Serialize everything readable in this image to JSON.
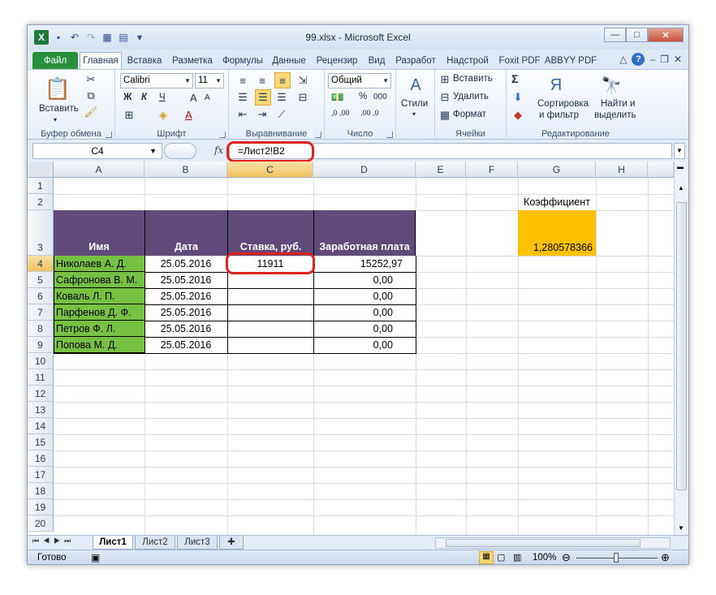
{
  "window": {
    "title": "99.xlsx - Microsoft Excel",
    "logo": "X",
    "buttons": {
      "minimize": "—",
      "maximize": "□",
      "close": "✕"
    }
  },
  "qat_icons": [
    "save-icon",
    "undo-icon",
    "redo-icon",
    "form-icon",
    "table-icon",
    "customize-icon"
  ],
  "tabs": [
    "Файл",
    "Главная",
    "Вставка",
    "Разметка",
    "Формулы",
    "Данные",
    "Рецензир",
    "Вид",
    "Разработ",
    "Надстрой",
    "Foxit PDF",
    "ABBYY PDF"
  ],
  "ribbon": {
    "clipboard": {
      "paste": "Вставить",
      "label": "Буфер обмена"
    },
    "font": {
      "name": "Calibri",
      "size": "11",
      "bold": "Ж",
      "italic": "К",
      "underline": "Ч",
      "grow": "A",
      "shrink": "A",
      "color": "A",
      "label": "Шрифт"
    },
    "alignment": {
      "label": "Выравнивание"
    },
    "number": {
      "format": "Общий",
      "percent": "%",
      "thousands": "000",
      "inc": ",0 ,00",
      "dec": ",00 ,0",
      "label": "Число"
    },
    "styles": {
      "label": "Стили"
    },
    "cells": {
      "insert": "Вставить",
      "delete": "Удалить",
      "format": "Формат",
      "label": "Ячейки"
    },
    "editing": {
      "sum": "Σ",
      "sort": "Сортировка\nи фильтр",
      "sort1": "Сортировка",
      "sort2": "и фильтр",
      "find1": "Найти и",
      "find2": "выделить",
      "label": "Редактирование"
    }
  },
  "formula_bar": {
    "name_box": "C4",
    "fx": "fx",
    "formula": "=Лист2!B2"
  },
  "columns": [
    "A",
    "B",
    "C",
    "D",
    "E",
    "F",
    "G",
    "H"
  ],
  "rows": [
    "1",
    "2",
    "3",
    "4",
    "5",
    "6",
    "7",
    "8",
    "9",
    "10",
    "11",
    "12",
    "13",
    "14",
    "15",
    "16",
    "17",
    "18",
    "19",
    "20"
  ],
  "table": {
    "headers": [
      "Имя",
      "Дата",
      "Ставка, руб.",
      "Заработная плата"
    ],
    "rows": [
      [
        "Николаев А. Д.",
        "25.05.2016",
        "11911",
        "15252,97"
      ],
      [
        "Сафронова В. М.",
        "25.05.2016",
        "",
        "0,00"
      ],
      [
        "Коваль Л. П.",
        "25.05.2016",
        "",
        "0,00"
      ],
      [
        "Парфенов Д. Ф.",
        "25.05.2016",
        "",
        "0,00"
      ],
      [
        "Петров Ф. Л.",
        "25.05.2016",
        "",
        "0,00"
      ],
      [
        "Попова М. Д.",
        "25.05.2016",
        "",
        "0,00"
      ]
    ]
  },
  "coefficient": {
    "label": "Коэффициент",
    "value": "1,280578366"
  },
  "sheets": [
    "Лист1",
    "Лист2",
    "Лист3"
  ],
  "status": {
    "ready": "Готово",
    "zoom": "100%"
  },
  "colors": {
    "header_purple": "#604a7b",
    "name_green": "#76c043",
    "coef_orange": "#ffc000",
    "highlight_red": "#e0201b",
    "file_tab": "#2a8f3b"
  }
}
